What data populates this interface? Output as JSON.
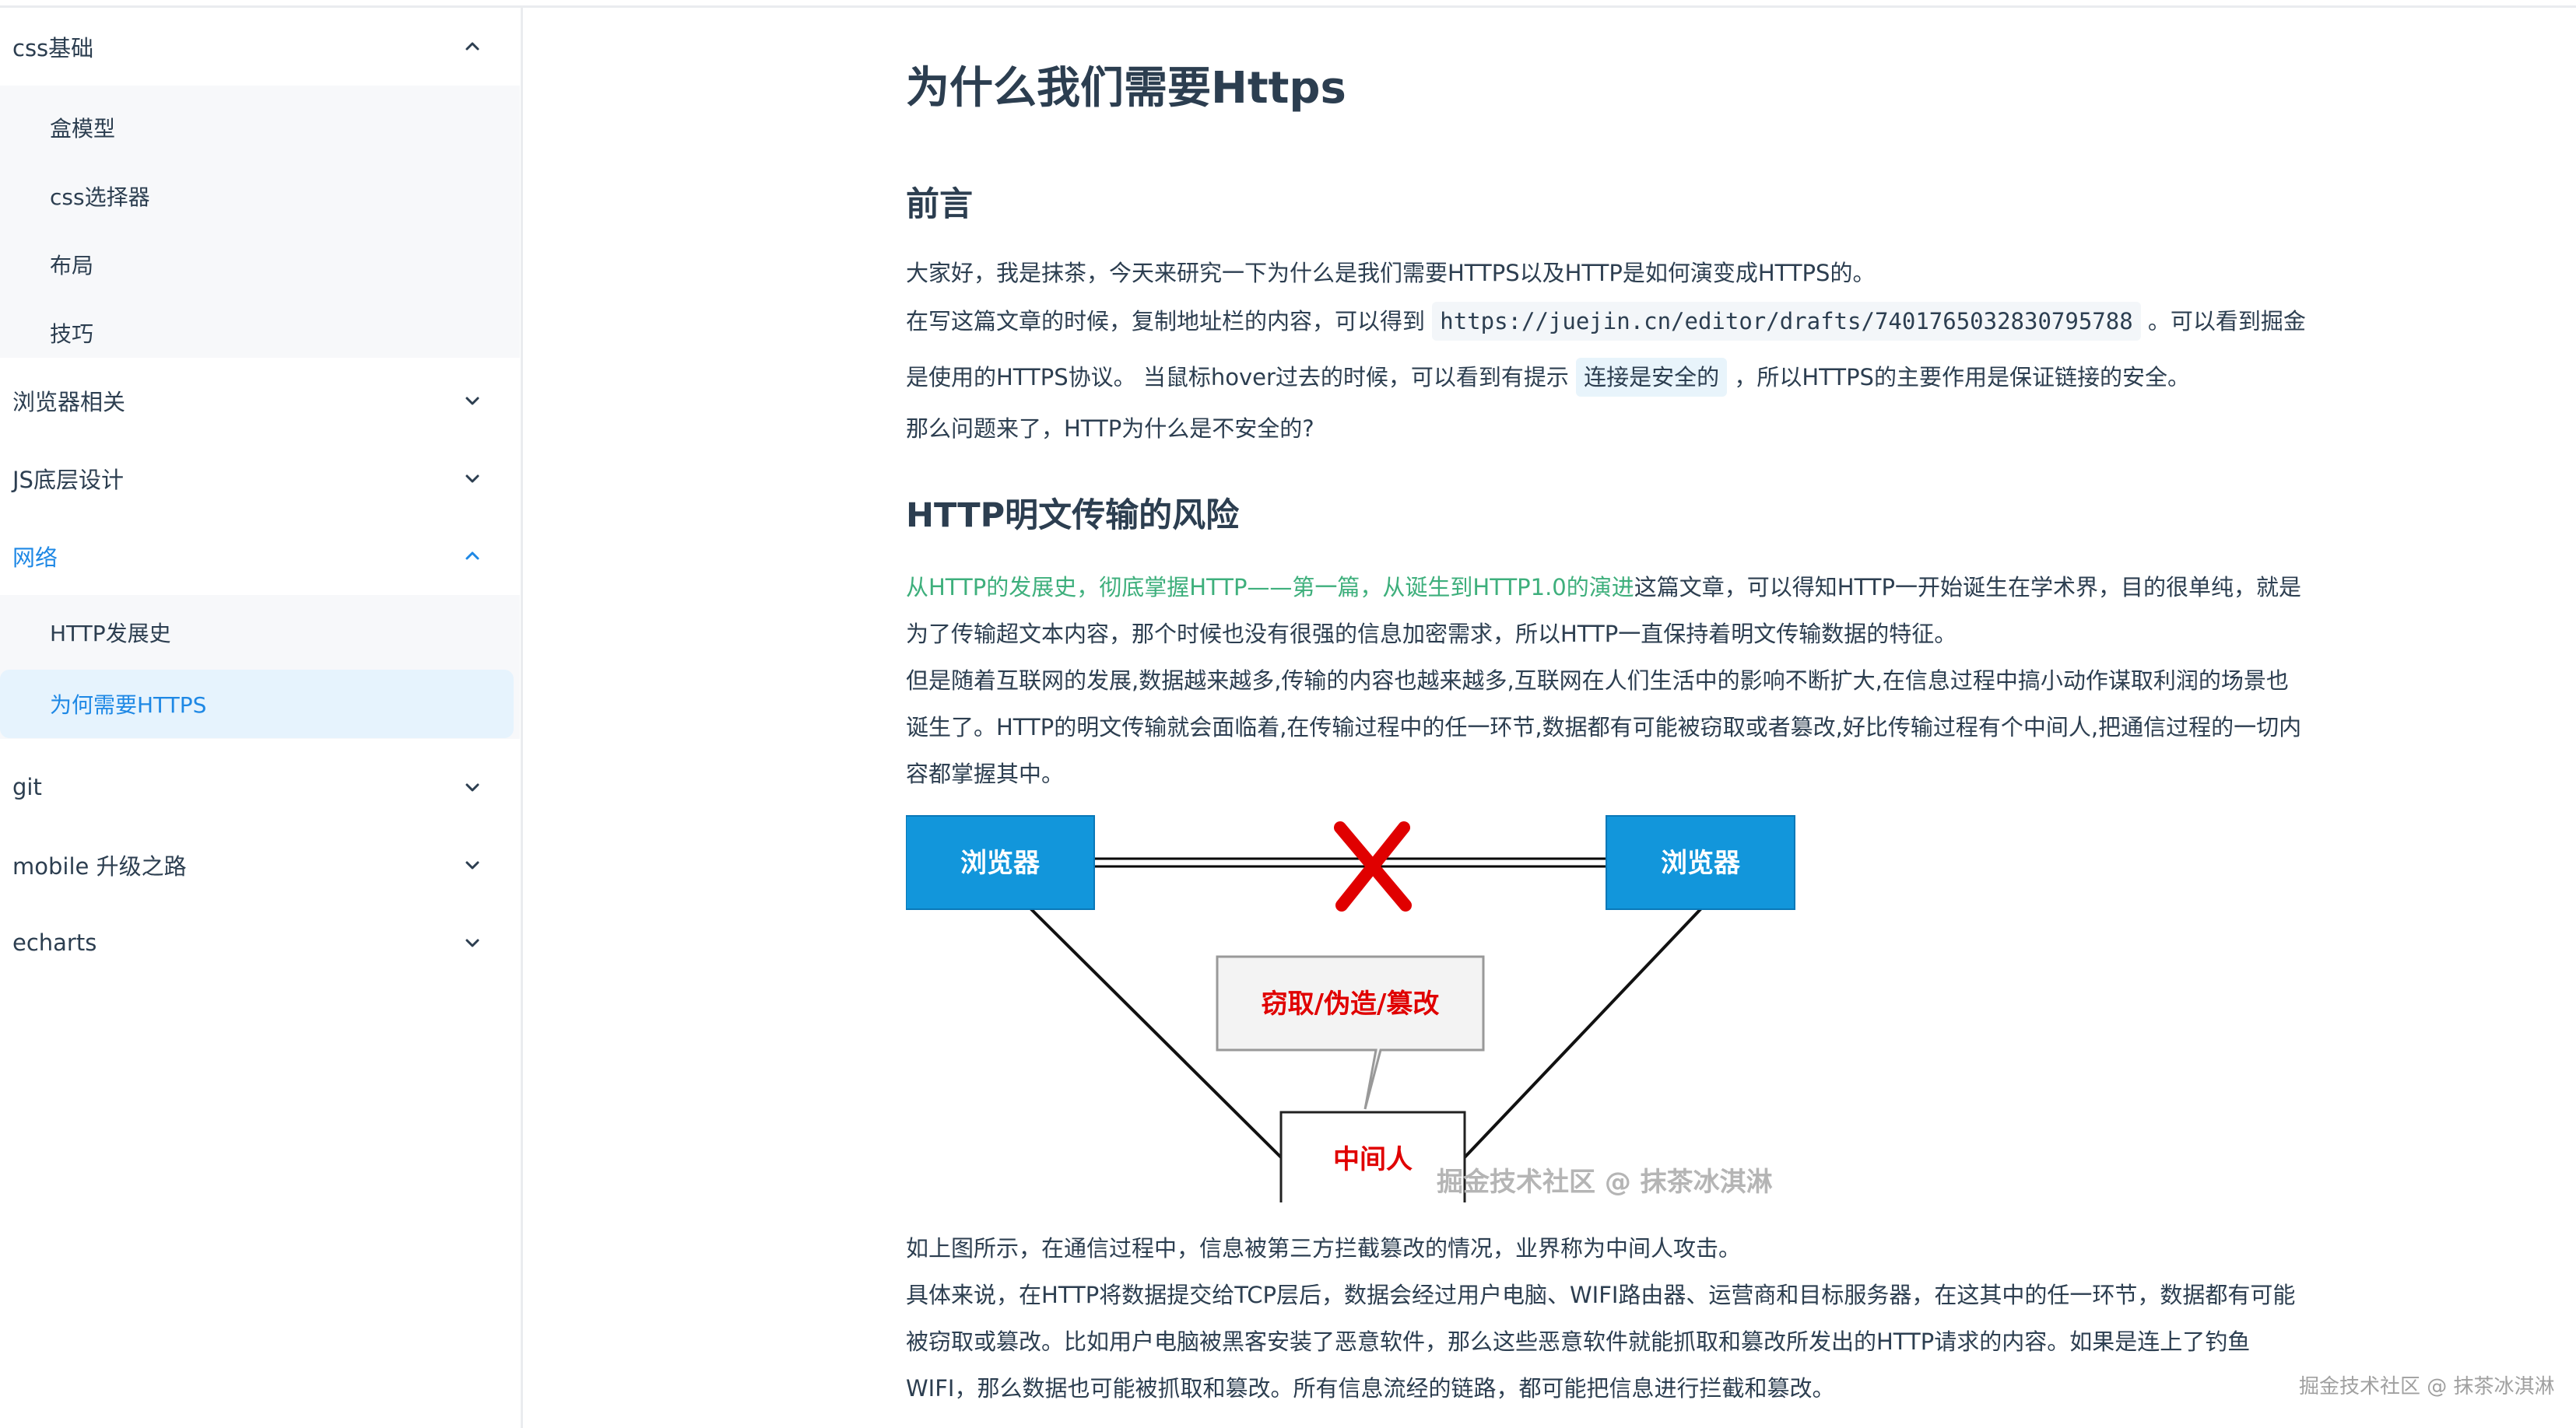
{
  "sidebar": {
    "groups": [
      {
        "label": "css基础",
        "expanded": true,
        "items": [
          "盒模型",
          "css选择器",
          "布局",
          "技巧"
        ]
      },
      {
        "label": "浏览器相关",
        "expanded": false
      },
      {
        "label": "JS底层设计",
        "expanded": false
      },
      {
        "label": "网络",
        "expanded": true,
        "items": [
          "HTTP发展史",
          "为何需要HTTPS"
        ],
        "selected": "为何需要HTTPS"
      },
      {
        "label": "git",
        "expanded": false
      },
      {
        "label": "mobile 升级之路",
        "expanded": false
      },
      {
        "label": "echarts",
        "expanded": false
      }
    ]
  },
  "article": {
    "title": "为什么我们需要Https",
    "sections": [
      {
        "heading": "前言",
        "lines": [
          "大家好，我是抹茶，今天来研究一下为什么是我们需要HTTPS以及HTTP是如何演变成HTTPS的。",
          "在写这篇文章的时候，复制地址栏的内容，可以得到",
          "https://juejin.cn/editor/drafts/7401765032830795788",
          "。可以看到掘金",
          "是使用的HTTPS协议。 当鼠标hover过去的时候，可以看到有提示",
          "连接是安全的",
          "，所以HTTPS的主要作用是保证链接的安全。",
          "那么问题来了，HTTP为什么是不安全的?"
        ]
      },
      {
        "heading": "HTTP明文传输的风险",
        "link_text": "从HTTP的发展史，彻底掌握HTTP——第一篇，从诞生到HTTP1.0的演进",
        "after_link": "这篇文章，可以得知HTTP一开始诞生在学术界，目的很单纯，就是",
        "lines": [
          "为了传输超文本内容，那个时候也没有很强的信息加密需求，所以HTTP一直保持着明文传输数据的特征。",
          "但是随着互联网的发展,数据越来越多,传输的内容也越来越多,互联网在人们生活中的影响不断扩大,在信息过程中搞小动作谋取利润的场景也",
          "诞生了。HTTP的明文传输就会面临着,在传输过程中的任一环节,数据都有可能被窃取或者篡改,好比传输过程有个中间人,把通信过程的一切内",
          "容都掌握其中。"
        ],
        "after_diagram": [
          "如上图所示，在通信过程中，信息被第三方拦截篡改的情况，业界称为中间人攻击。",
          "具体来说，在HTTP将数据提交给TCP层后，数据会经过用户电脑、WIFI路由器、运营商和目标服务器，在这其中的任一环节，数据都有可能",
          "被窃取或篡改。比如用户电脑被黑客安装了恶意软件，那么这些恶意软件就能抓取和篡改所发出的HTTP请求的内容。如果是连上了钓鱼",
          "WIFI，那么数据也可能被抓取和篡改。所有信息流经的链路，都可能把信息进行拦截和篡改。"
        ]
      }
    ]
  },
  "diagram": {
    "left_box": "浏览器",
    "right_box": "浏览器",
    "bubble": "窃取/伪造/篡改",
    "middle_box": "中间人",
    "watermark": "掘金技术社区 @ 抹茶冰淇淋",
    "colors": {
      "box": "#1296db",
      "cross": "#e00000",
      "bubble_text": "#e00000"
    }
  },
  "corner_watermark": "掘金技术社区 @ 抹茶冰淇淋"
}
